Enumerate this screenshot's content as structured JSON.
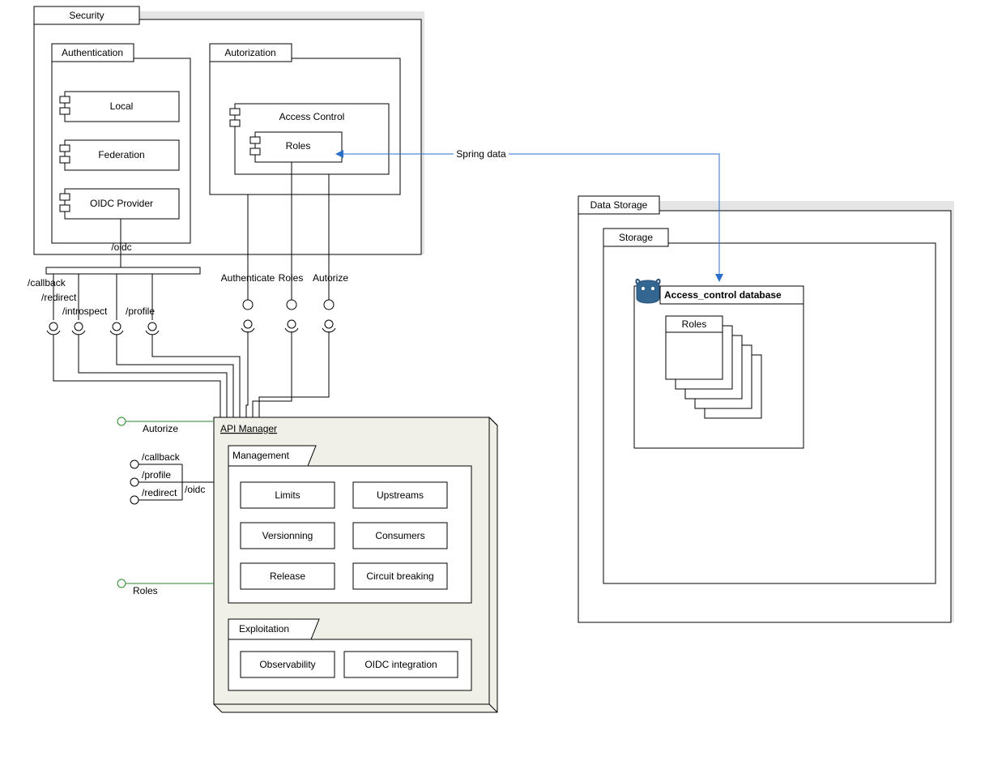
{
  "security": {
    "title": "Security",
    "authentication": {
      "title": "Authentication",
      "items": [
        "Local",
        "Federation",
        "OIDC Provider"
      ]
    },
    "authorization": {
      "title": "Autorization",
      "access_control": "Access Control",
      "roles": "Roles"
    }
  },
  "endpoints": {
    "oidc": "/oidc",
    "callback": "/callback",
    "redirect": "/redirect",
    "introspect": "/introspect",
    "profile": "/profile"
  },
  "ops": {
    "authenticate": "Authenticate",
    "roles": "Roles",
    "authorize": "Autorize"
  },
  "api": {
    "title": "API Manager",
    "management": {
      "title": "Management",
      "limits": "Limits",
      "upstreams": "Upstreams",
      "versioning": "Versionning",
      "consumers": "Consumers",
      "release": "Release",
      "circuit": "Circuit breaking"
    },
    "exploitation": {
      "title": "Exploitation",
      "observability": "Observability",
      "oidc_integration": "OIDC integration"
    },
    "left_interfaces": {
      "authorize": "Autorize",
      "callback": "/callback",
      "profile": "/profile",
      "redirect": "/redirect",
      "oidc": "/oidc",
      "roles": "Roles"
    }
  },
  "spring_data": "Spring data",
  "data_storage": {
    "title": "Data Storage",
    "storage": "Storage",
    "db": "Access_control database",
    "table": "Roles"
  }
}
